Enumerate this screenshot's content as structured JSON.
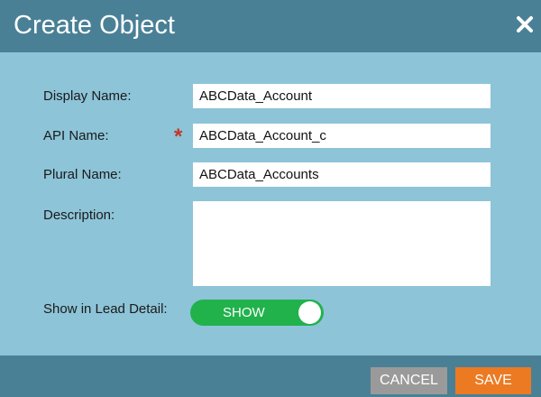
{
  "dialog": {
    "title": "Create Object",
    "close_icon": "close-icon"
  },
  "form": {
    "display_name": {
      "label": "Display Name:",
      "value": "ABCData_Account"
    },
    "api_name": {
      "label": "API Name:",
      "required_marker": "*",
      "value": "ABCData_Account_c"
    },
    "plural_name": {
      "label": "Plural Name:",
      "value": "ABCData_Accounts"
    },
    "description": {
      "label": "Description:",
      "value": ""
    },
    "show_in_lead_detail": {
      "label": "Show in Lead Detail:",
      "toggle_text": "SHOW",
      "state": "on"
    }
  },
  "footer": {
    "cancel_label": "CANCEL",
    "save_label": "SAVE"
  },
  "colors": {
    "header_bg": "#4a8096",
    "body_bg": "#8dc4d8",
    "toggle_on": "#22b24c",
    "save_button": "#ec7a22",
    "cancel_button": "#9a9a9a",
    "required": "#c0392b"
  }
}
